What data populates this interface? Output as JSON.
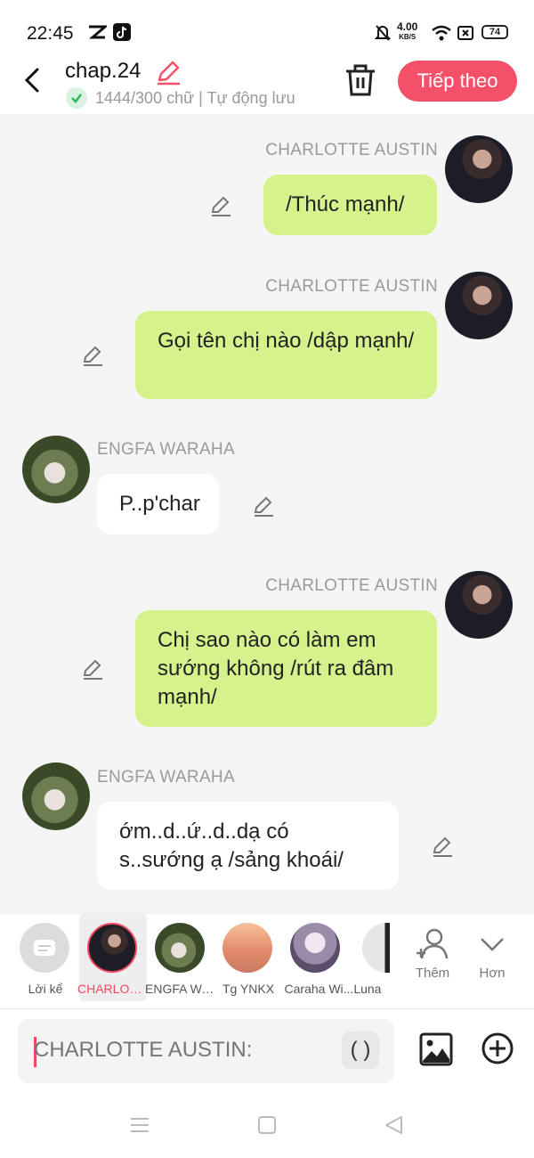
{
  "status": {
    "time": "22:45",
    "speed_value": "4.00",
    "speed_unit": "KB/S",
    "battery": "74"
  },
  "header": {
    "title": "chap.24",
    "save_status": "1444/300 chữ | Tự động lưu",
    "next_label": "Tiếp theo"
  },
  "messages": [
    {
      "sender": "CHARLOTTE AUSTIN",
      "text": "/Thúc mạnh/",
      "side": "right"
    },
    {
      "sender": "CHARLOTTE AUSTIN",
      "text": "Gọi tên chị nào /dập mạnh/",
      "side": "right"
    },
    {
      "sender": "ENGFA WARAHA",
      "text": "P..p'char",
      "side": "left"
    },
    {
      "sender": "CHARLOTTE AUSTIN",
      "text": "Chị sao nào có làm em sướng không /rút ra đâm mạnh/",
      "side": "right"
    },
    {
      "sender": "ENGFA WARAHA",
      "text": "ớm..d..ứ..d..dạ có s..sướng ạ /sảng khoái/",
      "side": "left"
    }
  ],
  "characters": [
    {
      "label": "Lời kể"
    },
    {
      "label": "CHARLOTTE AUSTIN",
      "active": true
    },
    {
      "label": "ENGFA WARAHA"
    },
    {
      "label": "Tg YNKX"
    },
    {
      "label": "Caraha Wi...Luna"
    },
    {
      "label": ""
    }
  ],
  "char_actions": {
    "add_label": "Thêm",
    "more_label": "Hơn"
  },
  "input": {
    "placeholder": "CHARLOTTE AUSTIN:",
    "paren_label": "( )"
  },
  "colors": {
    "accent": "#f5506a",
    "my_bubble": "#d5f28d",
    "other_bubble": "#ffffff",
    "background": "#f5f5f5"
  }
}
